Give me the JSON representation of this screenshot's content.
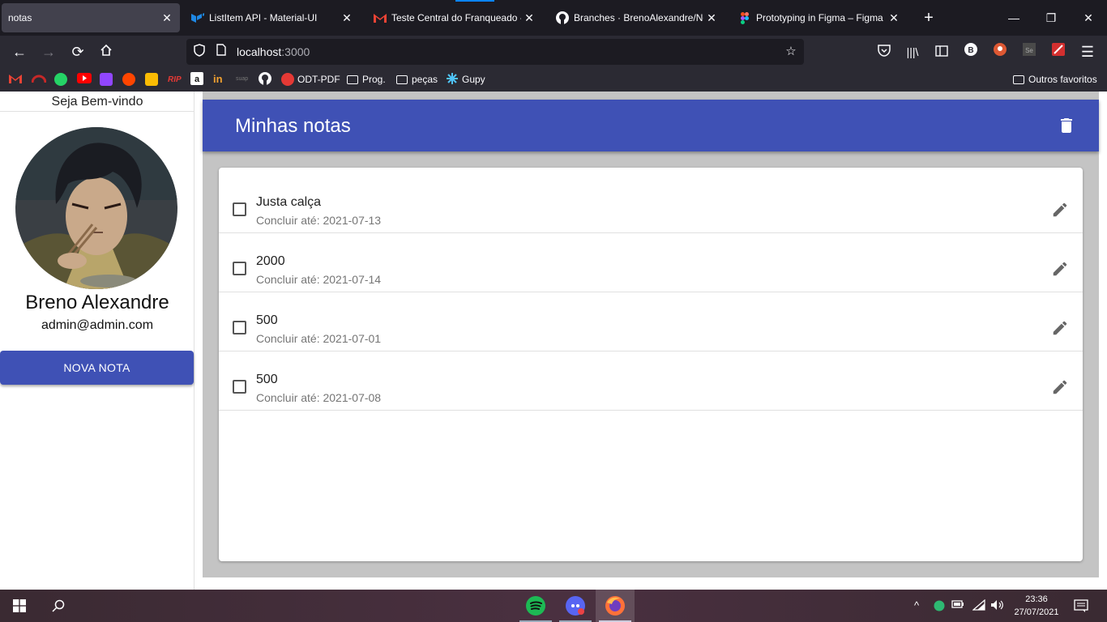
{
  "browser": {
    "tabs": [
      {
        "label": "notas",
        "active": true
      },
      {
        "label": "ListItem API - Material-UI",
        "active": false
      },
      {
        "label": "Teste Central do Franqueado - b",
        "active": false
      },
      {
        "label": "Branches · BrenoAlexandre/Not",
        "active": false
      },
      {
        "label": "Prototyping in Figma – Figma",
        "active": false
      }
    ],
    "url_host": "localhost",
    "url_port": ":3000",
    "bookmarks": {
      "rip": "RIP",
      "odt": "ODT-PDF",
      "prog": "Prog.",
      "pecas": "peças",
      "gupy": "Gupy",
      "outros": "Outros favoritos"
    }
  },
  "sidebar": {
    "welcome": "Seja Bem-vindo",
    "user_name": "Breno Alexandre",
    "user_email": "admin@admin.com",
    "new_note_label": "NOVA NOTA"
  },
  "main": {
    "title": "Minhas notas",
    "notes": [
      {
        "title": "Justa calça",
        "due": "Concluir até: 2021-07-13"
      },
      {
        "title": "2000",
        "due": "Concluir até: 2021-07-14"
      },
      {
        "title": "500",
        "due": "Concluir até: 2021-07-01"
      },
      {
        "title": "500",
        "due": "Concluir até: 2021-07-08"
      }
    ]
  },
  "taskbar": {
    "time": "23:36",
    "date": "27/07/2021"
  },
  "colors": {
    "primary": "#3f51b5",
    "main_bg": "#c4c4c4"
  }
}
